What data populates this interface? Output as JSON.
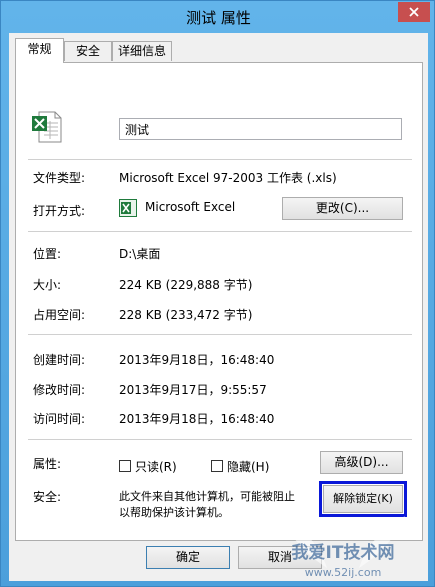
{
  "window": {
    "title": "测试 属性"
  },
  "tabs": [
    {
      "label": "常规"
    },
    {
      "label": "安全"
    },
    {
      "label": "详细信息"
    }
  ],
  "general": {
    "file_name": "测试",
    "file_type_label": "文件类型:",
    "file_type_value": "Microsoft Excel 97-2003 工作表 (.xls)",
    "opens_with_label": "打开方式:",
    "opens_with_value": "Microsoft Excel",
    "change_button": "更改(C)...",
    "location_label": "位置:",
    "location_value": "D:\\桌面",
    "size_label": "大小:",
    "size_value": "224 KB (229,888 字节)",
    "size_on_disk_label": "占用空间:",
    "size_on_disk_value": "228 KB (233,472 字节)",
    "created_label": "创建时间:",
    "created_value": "2013年9月18日，16:48:40",
    "modified_label": "修改时间:",
    "modified_value": "2013年9月17日，9:55:57",
    "accessed_label": "访问时间:",
    "accessed_value": "2013年9月18日，16:48:40",
    "attributes_label": "属性:",
    "readonly_label": "只读(R)",
    "hidden_label": "隐藏(H)",
    "advanced_button": "高级(D)...",
    "security_label": "安全:",
    "security_text_line1": "此文件来自其他计算机，可能被阻止",
    "security_text_line2": "以帮助保护该计算机。",
    "unblock_button": "解除锁定(K)"
  },
  "footer": {
    "ok_button": "确定",
    "cancel_button": "取消"
  },
  "watermark": {
    "text": "我爱IT技术网",
    "url": "www.52ij.com"
  },
  "colors": {
    "window_frame": "#54a4dd",
    "close_button": "#c74f4f",
    "highlight_box": "#0a18d8",
    "excel_green": "#1f7a3c"
  }
}
